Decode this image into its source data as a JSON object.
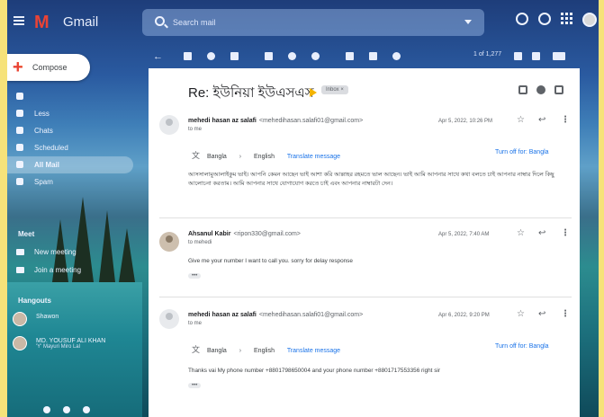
{
  "app": {
    "name": "Gmail",
    "logo_letter": "M"
  },
  "search": {
    "placeholder": "Search mail"
  },
  "toolbar": {
    "pager": "1 of 1,277"
  },
  "sidebar": {
    "compose_label": "Compose",
    "items": [
      {
        "label": "Less",
        "active": false
      },
      {
        "label": "Chats",
        "active": false
      },
      {
        "label": "Scheduled",
        "active": false
      },
      {
        "label": "All Mail",
        "active": true
      },
      {
        "label": "Spam",
        "active": false
      }
    ],
    "meet_heading": "Meet",
    "meet_items": [
      {
        "label": "New meeting"
      },
      {
        "label": "Join a meeting"
      }
    ],
    "hangouts_heading": "Hangouts",
    "hangouts_contacts": [
      {
        "name": "Shawon",
        "sub": ""
      },
      {
        "name": "MD. YOUSUF ALI KHAN",
        "sub": "'Y' Mayuri Miro Lal"
      }
    ]
  },
  "thread": {
    "subject": "Re: ইউনিয়া ইউএসএস",
    "label_chip": "Inbox ×",
    "messages": [
      {
        "sender": "mehedi hasan az salafi",
        "email": "<mehedihasan.salafi01@gmail.com>",
        "to": "to me",
        "date": "Apr 5, 2022, 10:26 PM",
        "translate": {
          "from_lang": "Bangla",
          "to_lang": "English",
          "translate_link": "Translate message",
          "turn_off": "Turn off for: Bangla"
        },
        "body": "আসসালামুআলাইকুম ভাই। আপনি কেমন আছেন ভাই আশা করি আল্লাহর রহমতে ভাল আছেন। ভাই আমি আপনার সাথে কথা বলতে চাই আপনার নাম্বার দিলে কিছু আলোচনা করতাম। আমি আপনার সাথে যোগাযোগ করতে চাই এবং আপনার নাম্বারটা দেন।"
      },
      {
        "sender": "Ahsanul Kabir",
        "email": "<ripon330@gmail.com>",
        "to": "to mehedi",
        "date": "Apr 5, 2022, 7:40 AM",
        "body": "Give me your number I want to call you. sorry for delay response"
      },
      {
        "sender": "mehedi hasan az salafi",
        "email": "<mehedihasan.salafi01@gmail.com>",
        "to": "to me",
        "date": "Apr 6, 2022, 9:20 PM",
        "translate": {
          "from_lang": "Bangla",
          "to_lang": "English",
          "translate_link": "Translate message",
          "turn_off": "Turn off for: Bangla"
        },
        "body": "Thanks vai My phone number +8801798650004 and your phone number +8801717553356 right sir"
      }
    ],
    "ellipsis": "•••"
  },
  "colors": {
    "accent": "#1a73e8",
    "important": "#f4b400",
    "brand_red": "#ea4335"
  }
}
